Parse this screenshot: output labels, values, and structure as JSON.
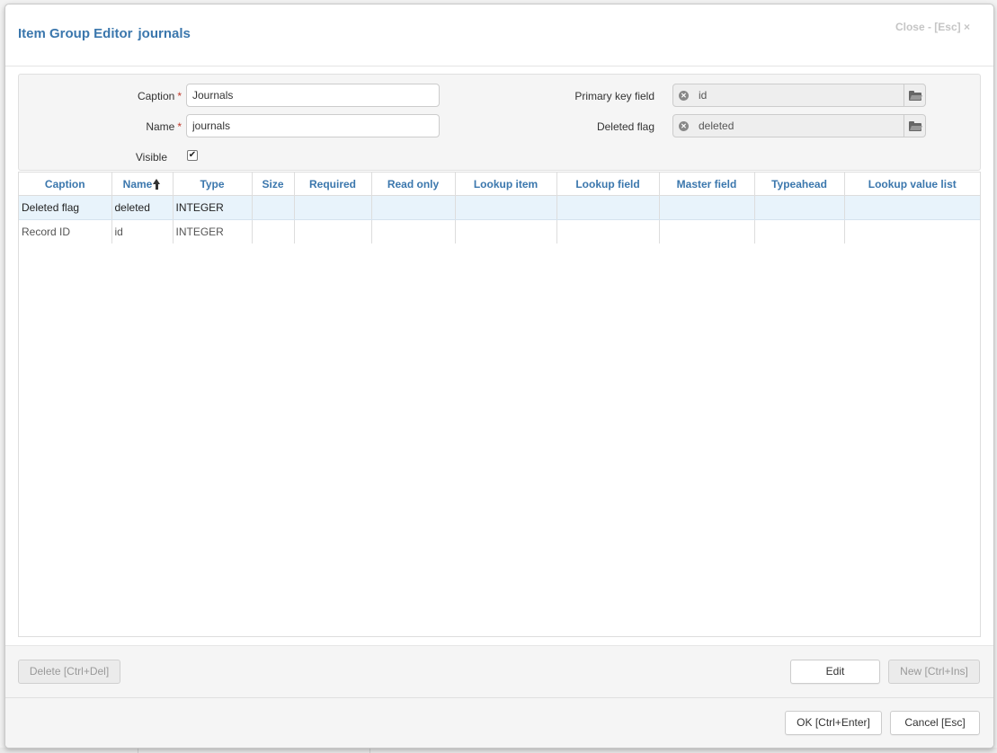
{
  "dialog": {
    "title": "Item Group Editor",
    "item_name": "journals",
    "close_label": "Close - [Esc] ×"
  },
  "form": {
    "caption": {
      "label": "Caption",
      "required_mark": "*",
      "value": "Journals"
    },
    "name": {
      "label": "Name",
      "required_mark": "*",
      "value": "journals"
    },
    "visible": {
      "label": "Visible",
      "checked": true
    },
    "primary_key": {
      "label": "Primary key field",
      "value": "id"
    },
    "deleted_flag": {
      "label": "Deleted flag",
      "value": "deleted"
    }
  },
  "grid": {
    "columns": [
      "Caption",
      "Name",
      "Type",
      "Size",
      "Required",
      "Read only",
      "Lookup item",
      "Lookup field",
      "Master field",
      "Typeahead",
      "Lookup value list"
    ],
    "sort_column": "Name",
    "sort_direction": "ascending",
    "rows": [
      {
        "caption": "Deleted flag",
        "name": "deleted",
        "type": "INTEGER",
        "selected": true
      },
      {
        "caption": "Record ID",
        "name": "id",
        "type": "INTEGER",
        "selected": false
      }
    ]
  },
  "actions": {
    "delete_label": "Delete [Ctrl+Del]",
    "edit_label": "Edit",
    "new_label": "New [Ctrl+Ins]"
  },
  "footer": {
    "ok_label": "OK [Ctrl+Enter]",
    "cancel_label": "Cancel [Esc]"
  },
  "colors": {
    "accent": "#3b77ad",
    "selected_row": "#e8f3fb",
    "required_mark": "#c0392b"
  }
}
